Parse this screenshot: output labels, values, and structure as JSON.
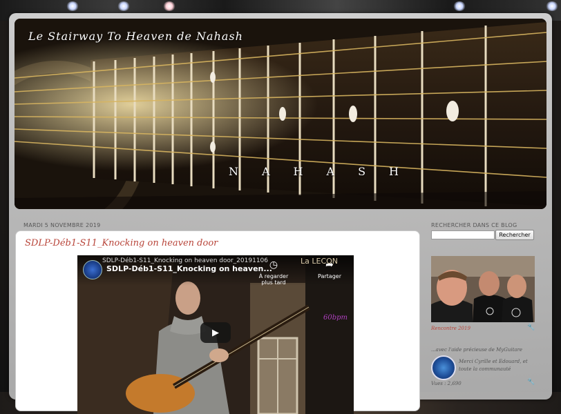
{
  "blog": {
    "title": "Le Stairway To Heaven de Nahash",
    "banner_signature": "NAHASH"
  },
  "post": {
    "date": "MARDI 5 NOVEMBRE 2019",
    "title": "SDLP-Déb1-S11_Knocking on heaven door",
    "video": {
      "filename": "SDLP-Déb1-S11_Knocking on heaven door_20191106",
      "title": "SDLP-Déb1-S11_Knocking on heaven...",
      "watch_later_label": "À regarder plus tard",
      "share_label": "Partager",
      "overlay_text": "La LECON",
      "tempo_text": "60bpm"
    }
  },
  "sidebar": {
    "search_title": "RECHERCHER DANS CE BLOG",
    "search_value": "",
    "search_button": "Rechercher",
    "photo_caption": "Rencontre 2019",
    "aid_text": "...avec l'aide précieuse de MyGuitare",
    "thanks_text": "Merci Cyrille et Edouard, et toute la communauté",
    "views_text": "Vues : 2,690"
  },
  "icons": {
    "watch_later": "clock-icon",
    "share": "share-arrow-icon",
    "play": "play-icon",
    "tool": "wrench-icon"
  },
  "colors": {
    "post_title": "#b8453a",
    "panel": "#d4d4d4"
  }
}
